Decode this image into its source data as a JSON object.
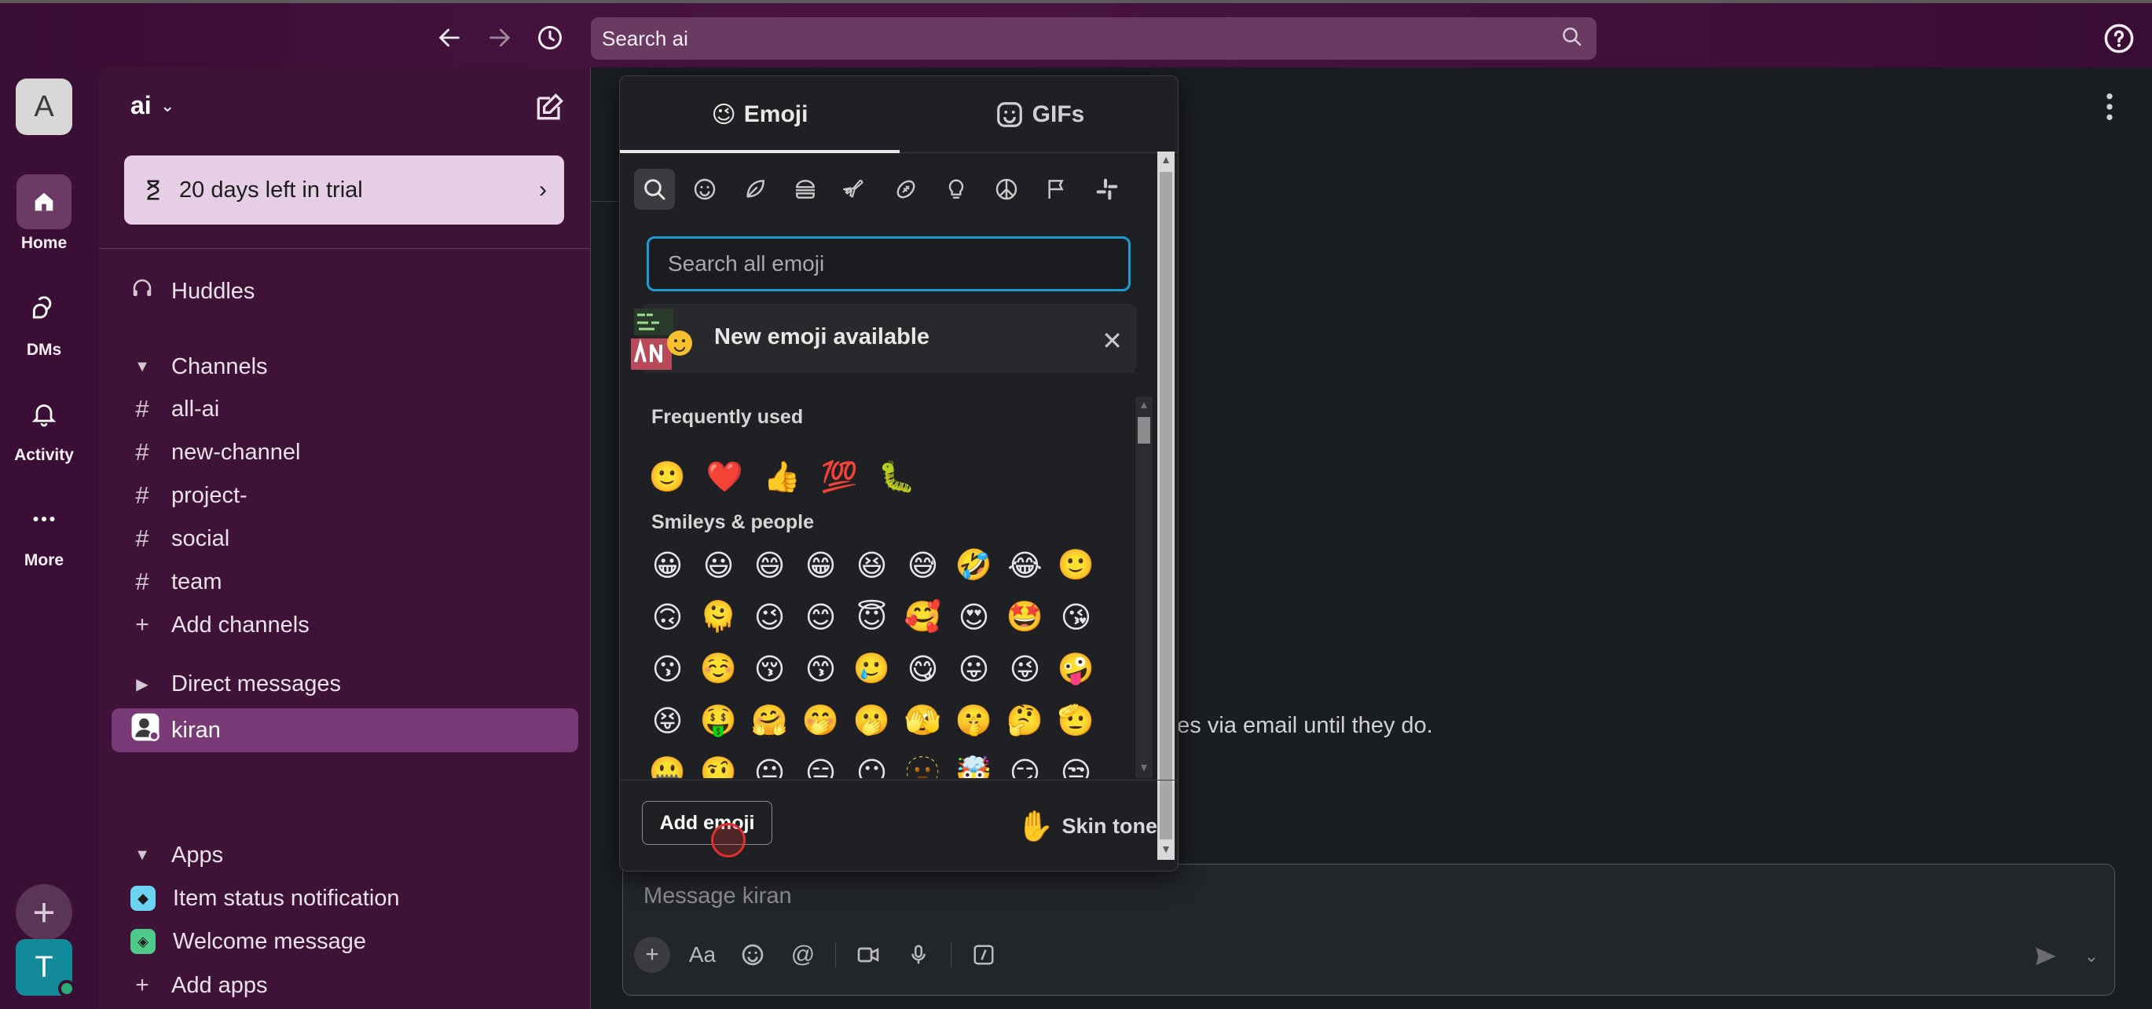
{
  "topbar": {
    "search_placeholder": "Search ai",
    "back_icon": "arrow-left-icon",
    "forward_icon": "arrow-right-icon",
    "history_icon": "clock-icon",
    "help_icon": "help-circle-icon"
  },
  "rail": {
    "workspace_initial": "A",
    "items": [
      {
        "label": "Home",
        "icon": "home-icon"
      },
      {
        "label": "DMs",
        "icon": "dm-icon"
      },
      {
        "label": "Activity",
        "icon": "bell-icon"
      },
      {
        "label": "More",
        "icon": "more-icon"
      }
    ],
    "user_initial": "T"
  },
  "sidebar": {
    "workspace_name": "ai",
    "trial_text": "20 days left in trial",
    "huddles": "Huddles",
    "channels_header": "Channels",
    "channels": [
      "all-ai",
      "new-channel",
      "project-",
      "social",
      "team"
    ],
    "add_channels": "Add channels",
    "dm_header": "Direct messages",
    "dms": [
      "kiran"
    ],
    "apps_header": "Apps",
    "apps": [
      "Item status notification",
      "Welcome message"
    ],
    "add_apps": "Add apps"
  },
  "main": {
    "background_text": "ges via email until they do.",
    "composer_placeholder": "Message kiran"
  },
  "emoji_picker": {
    "tab_emoji": "Emoji",
    "tab_gifs": "GIFs",
    "search_placeholder": "Search all emoji",
    "banner_text": "New emoji available",
    "frequently_used_title": "Frequently used",
    "frequently_used": [
      "🙂",
      "❤️",
      "👍",
      "💯",
      "🐛"
    ],
    "smileys_title": "Smileys & people",
    "smileys": [
      [
        "😀",
        "😃",
        "😄",
        "😁",
        "😆",
        "😅",
        "🤣",
        "😂",
        "🙂"
      ],
      [
        "🙃",
        "🫠",
        "😉",
        "😊",
        "😇",
        "🥰",
        "😍",
        "🤩",
        "😘"
      ],
      [
        "😗",
        "☺️",
        "😚",
        "😙",
        "🥲",
        "😋",
        "😛",
        "😜",
        "🤪"
      ],
      [
        "😝",
        "🤑",
        "🤗",
        "🤭",
        "🫢",
        "🫣",
        "🤫",
        "🤔",
        "🫡"
      ],
      [
        "🤐",
        "🤨",
        "😐",
        "😑",
        "😶",
        "🫥",
        "🤯",
        "😏",
        "😒"
      ]
    ],
    "add_emoji_label": "Add emoji",
    "skin_tone_label": "Skin tone",
    "skin_tone_emoji": "✋"
  }
}
